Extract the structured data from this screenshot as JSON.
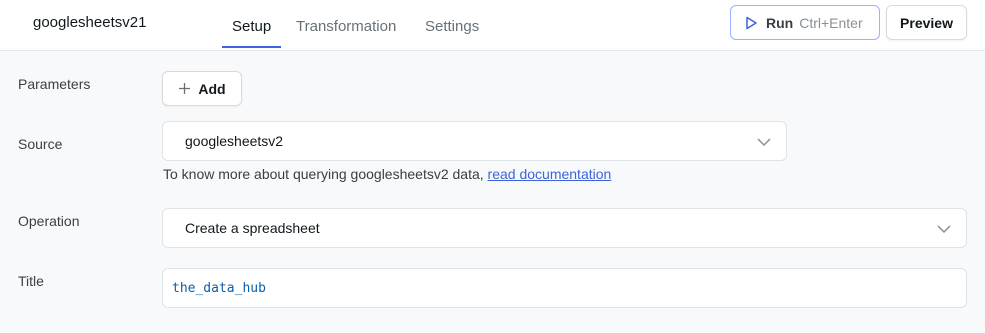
{
  "header": {
    "query_name": "googlesheetsv21",
    "tabs": [
      {
        "label": "Setup",
        "active": true
      },
      {
        "label": "Transformation",
        "active": false
      },
      {
        "label": "Settings",
        "active": false
      }
    ],
    "run_button": {
      "label": "Run",
      "shortcut": "Ctrl+Enter",
      "icon": "play-icon"
    },
    "preview_button": {
      "label": "Preview"
    }
  },
  "form": {
    "parameters": {
      "label": "Parameters",
      "add_button": "Add",
      "add_icon": "plus-icon"
    },
    "source": {
      "label": "Source",
      "selected": "googlesheetsv2",
      "helper_text": "To know more about querying googlesheetsv2 data, ",
      "helper_link": "read documentation"
    },
    "operation": {
      "label": "Operation",
      "selected": "Create a spreadsheet"
    },
    "title": {
      "label": "Title",
      "value": "the_data_hub"
    }
  },
  "colors": {
    "accent": "#3e63dd",
    "page_bg": "#f8f9fa",
    "code_text": "#0b5ea8"
  }
}
